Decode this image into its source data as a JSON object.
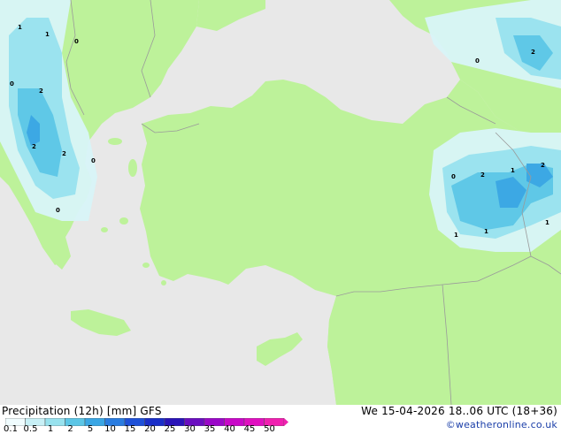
{
  "map": {
    "colors": {
      "sea": "#e8e8e8",
      "land": "#bdf29a",
      "precip_light": "#d8f4f8",
      "precip_mid": "#98e2ee",
      "precip_strong": "#5cc6e6",
      "precip_heavy": "#3aa6e4",
      "border": "#9a9a9a"
    },
    "values": [
      "1",
      "1",
      "0",
      "0",
      "2",
      "2",
      "2",
      "0",
      "0",
      "0",
      "2",
      "0",
      "2",
      "1",
      "2",
      "1",
      "1",
      "1"
    ]
  },
  "footer": {
    "title": "Precipitation (12h) [mm] GFS",
    "datetime": "We 15-04-2026 18..06 UTC (18+36)",
    "credit": "©weatheronline.co.uk",
    "scale": {
      "labels": [
        "0.1",
        "0.5",
        "1",
        "2",
        "5",
        "10",
        "15",
        "20",
        "25",
        "30",
        "35",
        "40",
        "45",
        "50"
      ],
      "colors": [
        "#f0fcfe",
        "#c8f0f6",
        "#98e2ee",
        "#5cc6e6",
        "#3aa6e4",
        "#2a7ce0",
        "#1e50d8",
        "#1a2ec8",
        "#2a14b8",
        "#6a0ec0",
        "#9a08c8",
        "#c808c8",
        "#e010c0",
        "#f020b0"
      ]
    }
  }
}
